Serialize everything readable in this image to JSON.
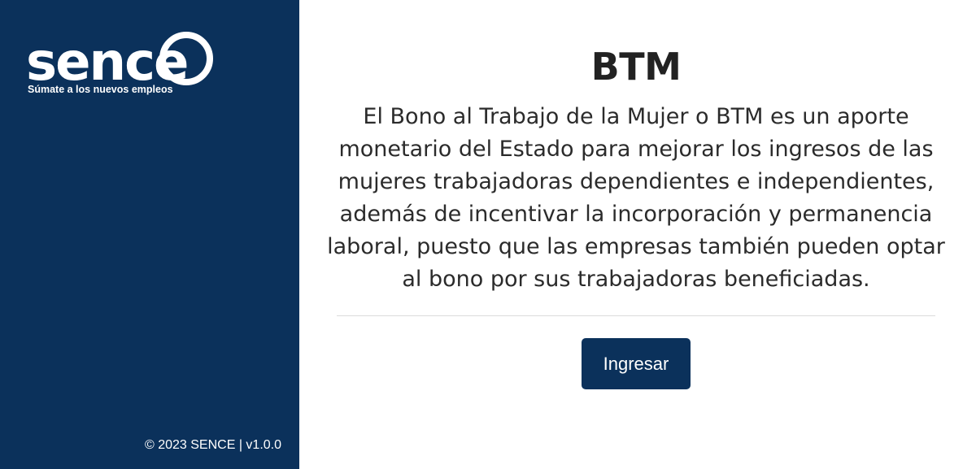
{
  "sidebar": {
    "logo_text": "sence",
    "logo_tagline": "Súmate a los nuevos empleos",
    "footer": "© 2023 SENCE | v1.0.0"
  },
  "main": {
    "title": "BTM",
    "description": "El Bono al Trabajo de la Mujer o BTM es un aporte monetario del Estado para mejorar los ingresos de las mujeres trabajadoras dependientes e independientes, además de incentivar la incorporación y permanencia laboral, puesto que las empresas también pueden optar al bono por sus trabajadoras beneficiadas.",
    "button_label": "Ingresar"
  },
  "colors": {
    "brand": "#0b315b",
    "background": "#ffffff"
  }
}
